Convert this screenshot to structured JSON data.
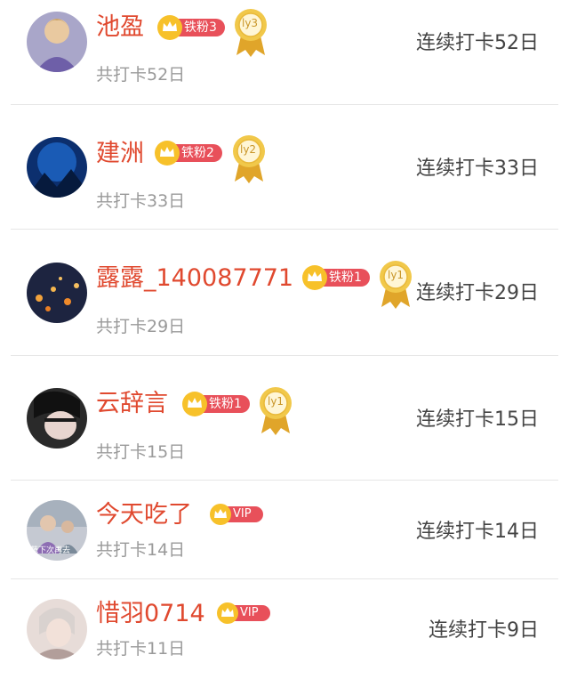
{
  "colors": {
    "name": "#e0492f",
    "badge": "#e8505a",
    "crown": "#f7c12a",
    "medal": "#e9b93a",
    "sub": "#9a9a9a"
  },
  "rows": [
    {
      "name": "池盈",
      "badge": "铁粉3",
      "level": "ly3",
      "total": "共打卡52日",
      "streak": "连续打卡52日",
      "avatar": "avatar"
    },
    {
      "name": "建洲",
      "badge": "铁粉2",
      "level": "ly2",
      "total": "共打卡33日",
      "streak": "连续打卡33日",
      "avatar": "avatar"
    },
    {
      "name": "露露_140087771",
      "badge": "铁粉1",
      "level": "ly1",
      "total": "共打卡29日",
      "streak": "连续打卡29日",
      "avatar": "avatar"
    },
    {
      "name": "云辞言",
      "badge": "铁粉1",
      "level": "ly1",
      "total": "共打卡15日",
      "streak": "连续打卡15日",
      "avatar": "avatar"
    },
    {
      "name": "今天吃了",
      "vip": "VIP",
      "total": "共打卡14日",
      "streak": "连续打卡14日",
      "avatar": "avatar",
      "avatar_caption": "蔬下次再去"
    },
    {
      "name": "惜羽0714",
      "vip": "VIP",
      "total": "共打卡11日",
      "streak": "连续打卡9日",
      "avatar": "avatar"
    }
  ]
}
